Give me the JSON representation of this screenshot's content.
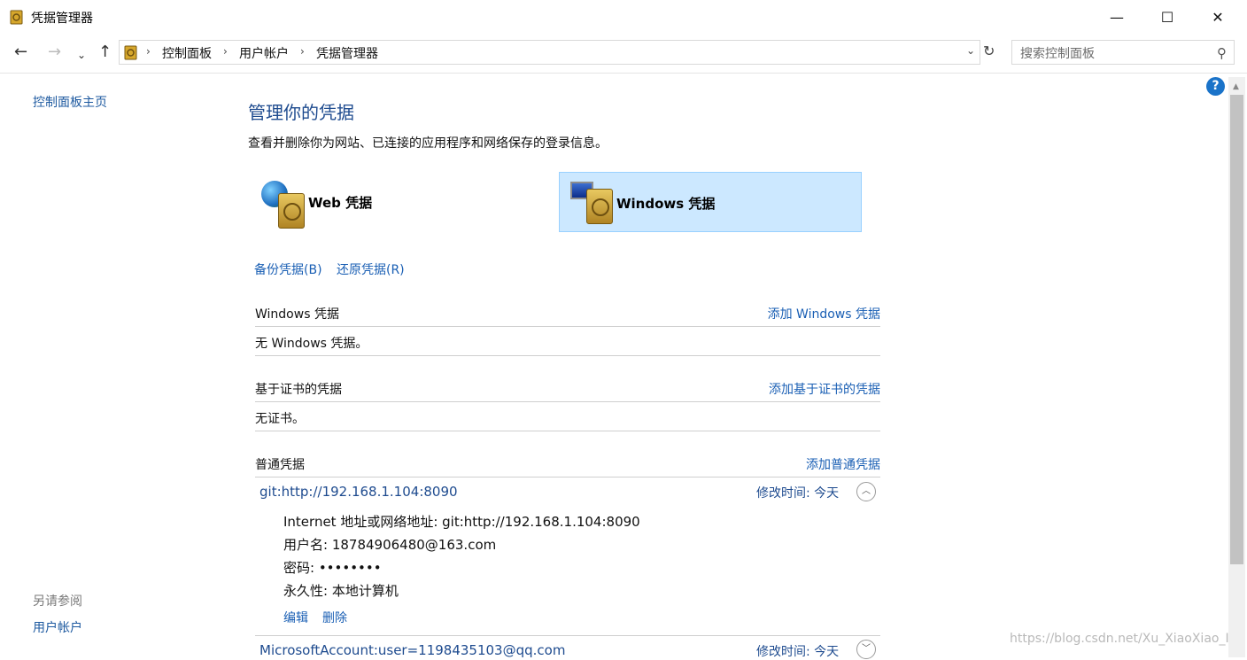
{
  "window": {
    "title": "凭据管理器",
    "controls": {
      "minimize": "—",
      "maximize": "☐",
      "close": "✕"
    }
  },
  "navbar": {
    "breadcrumbs": [
      "控制面板",
      "用户帐户",
      "凭据管理器"
    ],
    "search_placeholder": "搜索控制面板"
  },
  "sidebar": {
    "home_link": "控制面板主页",
    "see_also_label": "另请参阅",
    "see_also_links": [
      "用户帐户"
    ]
  },
  "main": {
    "heading": "管理你的凭据",
    "description": "查看并删除你为网站、已连接的应用程序和网络保存的登录信息。",
    "tiles": [
      {
        "label": "Web 凭据",
        "selected": false
      },
      {
        "label": "Windows 凭据",
        "selected": true
      }
    ],
    "backup_link": "备份凭据(B)",
    "restore_link": "还原凭据(R)",
    "sections": {
      "windows": {
        "title": "Windows 凭据",
        "add_link": "添加 Windows 凭据",
        "empty_text": "无 Windows 凭据。"
      },
      "cert": {
        "title": "基于证书的凭据",
        "add_link": "添加基于证书的凭据",
        "empty_text": "无证书。"
      },
      "generic": {
        "title": "普通凭据",
        "add_link": "添加普通凭据"
      }
    },
    "credentials": [
      {
        "name": "git:http://192.168.1.104:8090",
        "modified": "修改时间:  今天",
        "expanded": true,
        "details": [
          "Internet 地址或网络地址:  git:http://192.168.1.104:8090",
          "用户名:  18784906480@163.com",
          "密码:  ••••••••",
          "永久性:  本地计算机"
        ],
        "edit_label": "编辑",
        "delete_label": "删除"
      },
      {
        "name": "MicrosoftAccount:user=1198435103@qq.com",
        "modified": "修改时间:  今天",
        "expanded": false
      }
    ]
  },
  "watermark": "https://blog.csdn.net/Xu_XiaoXiao_I",
  "colors": {
    "accent": "#1a5fb4",
    "heading": "#1e4b8f",
    "selected_tile_bg": "#cce8ff"
  }
}
